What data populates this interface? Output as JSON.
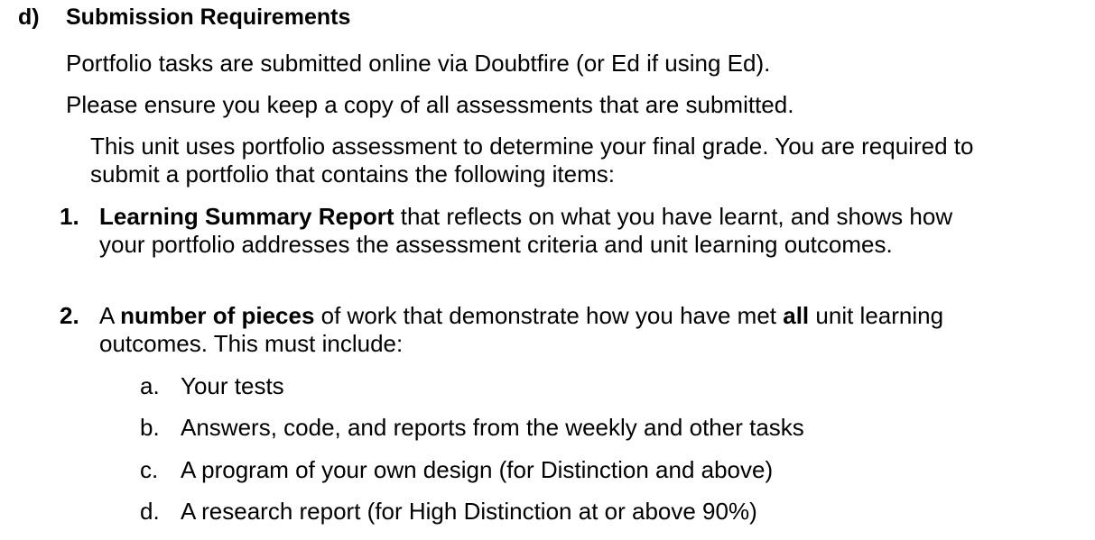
{
  "section": {
    "letter": "d)",
    "title": "Submission Requirements"
  },
  "paragraphs": [
    "Portfolio tasks are submitted online via Doubtfire (or Ed if using Ed).",
    "Please ensure you keep a copy of all assessments that are submitted.",
    "This unit uses portfolio assessment to determine your final grade. You are required to submit a portfolio that contains the following items:"
  ],
  "items": [
    {
      "number": "1.",
      "bold_lead": "Learning Summary Report",
      "rest": " that reflects on what you have learnt, and shows how your portfolio addresses the assessment criteria and unit learning outcomes."
    },
    {
      "number": "2.",
      "pre": "A ",
      "bold_1": "number of pieces",
      "mid": " of work that demonstrate how you have met ",
      "bold_2": "all",
      "post": " unit learning outcomes. This must include:"
    }
  ],
  "subitems": [
    {
      "letter": "a.",
      "text": "Your tests"
    },
    {
      "letter": "b.",
      "text": "Answers, code, and reports from the weekly and other tasks"
    },
    {
      "letter": "c.",
      "text": "A program of your own design (for Distinction and above)"
    },
    {
      "letter": "d.",
      "text": "A research report (for High Distinction at or above 90%)"
    }
  ]
}
